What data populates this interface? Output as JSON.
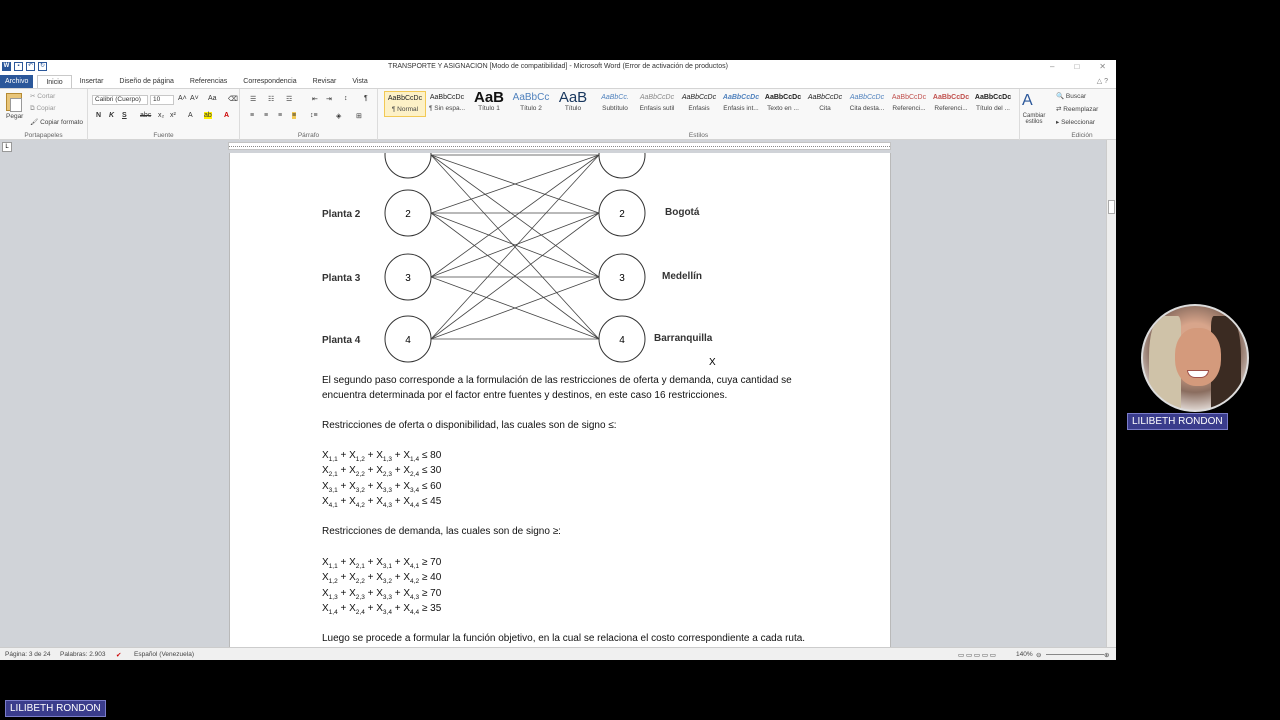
{
  "window": {
    "title": "TRANSPORTE Y ASIGNACION [Modo de compatibilidad]  -  Microsoft Word (Error de activación de productos)",
    "minimize": "–",
    "maximize": "□",
    "close": "✕"
  },
  "tabs": [
    "Archivo",
    "Inicio",
    "Insertar",
    "Diseño de página",
    "Referencias",
    "Correspondencia",
    "Revisar",
    "Vista"
  ],
  "ribbon": {
    "clipboard": {
      "paste": "Pegar",
      "cut": "Cortar",
      "copy": "Copiar",
      "format_painter": "Copiar formato",
      "label": "Portapapeles"
    },
    "font": {
      "name": "Calibri (Cuerpo)",
      "size": "10",
      "label": "Fuente",
      "bold": "N",
      "italic": "K",
      "underline": "S"
    },
    "paragraph": {
      "label": "Párrafo"
    },
    "styles": {
      "label": "Estilos",
      "items": [
        {
          "preview": "AaBbCcDc",
          "name": "¶ Normal"
        },
        {
          "preview": "AaBbCcDc",
          "name": "¶ Sin espa..."
        },
        {
          "preview": "AaB",
          "name": "Título 1"
        },
        {
          "preview": "AaBbCc",
          "name": "Título 2"
        },
        {
          "preview": "AaB",
          "name": "Título"
        },
        {
          "preview": "AaBbCc.",
          "name": "Subtítulo"
        },
        {
          "preview": "AaBbCcDc",
          "name": "Énfasis sutil"
        },
        {
          "preview": "AaBbCcDc",
          "name": "Énfasis"
        },
        {
          "preview": "AaBbCcDc",
          "name": "Énfasis int..."
        },
        {
          "preview": "AaBbCcDc",
          "name": "Texto en ..."
        },
        {
          "preview": "AaBbCcDc",
          "name": "Cita"
        },
        {
          "preview": "AaBbCcDc",
          "name": "Cita desta..."
        },
        {
          "preview": "AaBbCcDc",
          "name": "Referenci..."
        },
        {
          "preview": "AaBbCcDc",
          "name": "Referenci..."
        },
        {
          "preview": "AaBbCcDc",
          "name": "Título del ..."
        }
      ],
      "change": "Cambiar estilos"
    },
    "editing": {
      "find": "Buscar",
      "replace": "Reemplazar",
      "select": "Seleccionar",
      "label": "Edición"
    }
  },
  "diagram": {
    "sources": [
      "Planta 2",
      "Planta 3",
      "Planta 4"
    ],
    "source_nodes": [
      "2",
      "3",
      "4"
    ],
    "dest_nodes": [
      "2",
      "3",
      "4"
    ],
    "destinations": [
      "Bogotá",
      "Medellín",
      "Barranquilla"
    ],
    "mark": "X"
  },
  "document": {
    "para1": "El segundo paso corresponde a la formulación de las restricciones de oferta y demanda, cuya cantidad se encuentra determinada por el factor entre fuentes y destinos, en este caso 16 restricciones.",
    "para2": "Restricciones de oferta o disponibilidad, las cuales son de signo ≤:",
    "supply": [
      {
        "i": "1",
        "op": "≤",
        "rhs": "80"
      },
      {
        "i": "2",
        "op": "≤",
        "rhs": "30"
      },
      {
        "i": "3",
        "op": "≤",
        "rhs": "60"
      },
      {
        "i": "4",
        "op": "≤",
        "rhs": "45"
      }
    ],
    "para3": "Restricciones de demanda, las cuales son de signo ≥:",
    "demand": [
      {
        "j": "1",
        "op": "≥",
        "rhs": "70"
      },
      {
        "j": "2",
        "op": "≥",
        "rhs": "40"
      },
      {
        "j": "3",
        "op": "≥",
        "rhs": "70"
      },
      {
        "j": "4",
        "op": "≥",
        "rhs": "35"
      }
    ],
    "para4": "Luego se procede a formular la función objetivo, en la cual se relaciona el costo correspondiente a cada ruta."
  },
  "status": {
    "page": "Página: 3 de 24",
    "words": "Palabras: 2.903",
    "language": "Español (Venezuela)",
    "zoom": "140%"
  },
  "presenter": {
    "name": "LILIBETH RONDON"
  }
}
